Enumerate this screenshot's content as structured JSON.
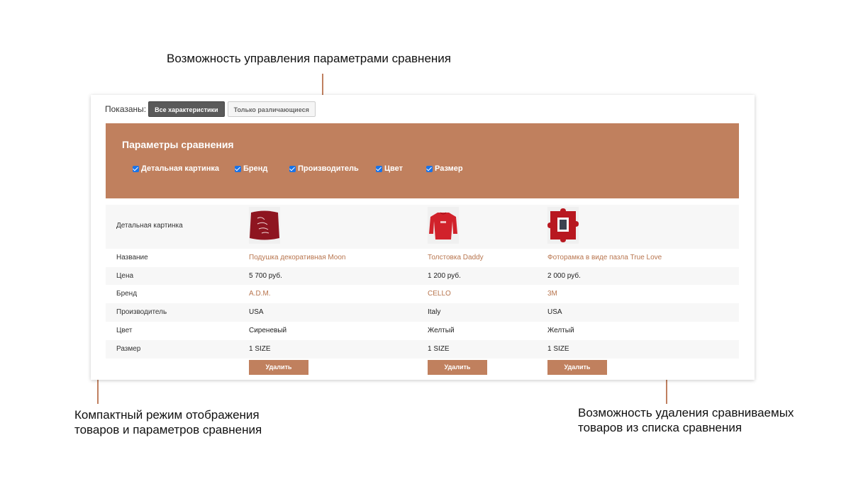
{
  "annotations": {
    "top": "Возможность управления параметрами сравнения",
    "left_line1": "Компактный режим отображения",
    "left_line2": "товаров и параметров сравнения",
    "right_line1": "Возможность удаления сравниваемых",
    "right_line2": "товаров из списка сравнения"
  },
  "toolbar": {
    "shown_label": "Показаны:",
    "all_label": "Все характеристики",
    "diff_label": "Только различающиеся"
  },
  "params": {
    "title": "Параметры сравнения",
    "items": [
      {
        "label": "Детальная картинка",
        "checked": true
      },
      {
        "label": "Бренд",
        "checked": true
      },
      {
        "label": "Производитель",
        "checked": true
      },
      {
        "label": "Цвет",
        "checked": true
      },
      {
        "label": "Размер",
        "checked": true
      }
    ]
  },
  "table": {
    "labels": {
      "picture": "Детальная картинка",
      "name": "Название",
      "price": "Цена",
      "brand": "Бренд",
      "maker": "Производитель",
      "color": "Цвет",
      "size": "Размер"
    },
    "products": [
      {
        "name": "Подушка декоративная Moon",
        "price": "5 700 руб.",
        "brand": "A.D.M.",
        "maker": "USA",
        "color": "Сиреневый",
        "size": "1 SIZE",
        "image": "pillow-image"
      },
      {
        "name": "Толстовка Daddy",
        "price": "1 200 руб.",
        "brand": "CELLO",
        "maker": "Italy",
        "color": "Желтый",
        "size": "1 SIZE",
        "image": "sweatshirt-image"
      },
      {
        "name": "Фоторамка в виде пазла True Love",
        "price": "2 000 руб.",
        "brand": "3M",
        "maker": "USA",
        "color": "Желтый",
        "size": "1 SIZE",
        "image": "puzzle-frame-image"
      }
    ],
    "delete_label": "Удалить"
  },
  "colors": {
    "accent": "#c0805e",
    "link": "#b8754e",
    "active_button": "#5a5a5a"
  }
}
